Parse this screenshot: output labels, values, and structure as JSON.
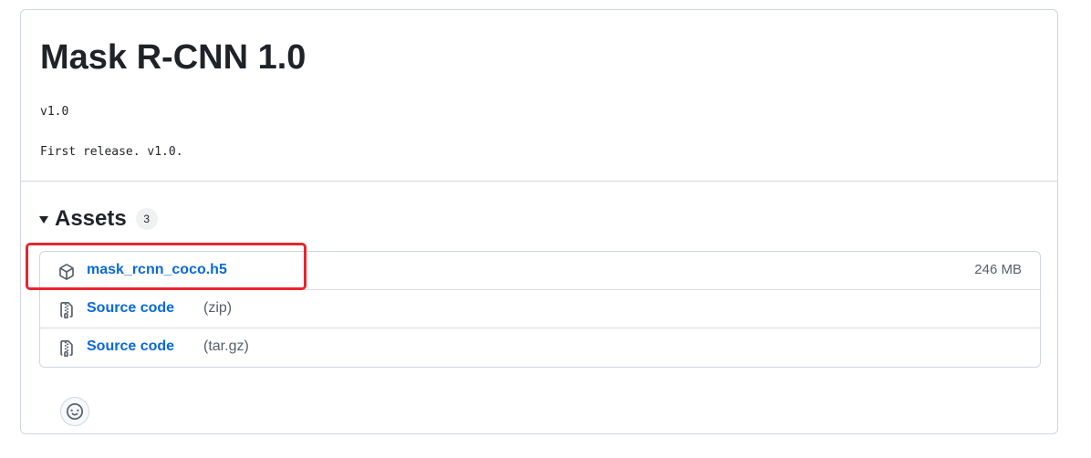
{
  "release": {
    "title": "Mask R-CNN 1.0",
    "tag": "v1.0",
    "notes": "First release. v1.0."
  },
  "assets": {
    "label": "Assets",
    "count": "3",
    "items": [
      {
        "name": "mask_rcnn_coco.h5",
        "meta": "",
        "size": "246 MB",
        "icon": "package-icon"
      },
      {
        "name": "Source code",
        "meta": "(zip)",
        "size": "",
        "icon": "file-zip-icon"
      },
      {
        "name": "Source code",
        "meta": "(tar.gz)",
        "size": "",
        "icon": "file-zip-icon"
      }
    ]
  },
  "reaction": {
    "icon": "smiley-icon"
  },
  "colors": {
    "link": "#0969da",
    "border": "#d0d7de",
    "muted": "#57606a",
    "highlight": "#e8262e"
  }
}
